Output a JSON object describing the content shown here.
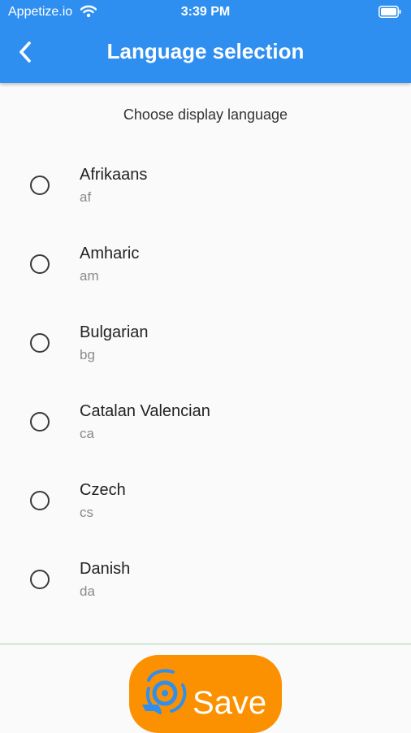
{
  "status_bar": {
    "carrier": "Appetize.io",
    "time": "3:39 PM"
  },
  "header": {
    "title": "Language selection"
  },
  "subtitle": "Choose display language",
  "languages": [
    {
      "name": "Afrikaans",
      "code": "af"
    },
    {
      "name": "Amharic",
      "code": "am"
    },
    {
      "name": "Bulgarian",
      "code": "bg"
    },
    {
      "name": "Catalan Valencian",
      "code": "ca"
    },
    {
      "name": "Czech",
      "code": "cs"
    },
    {
      "name": "Danish",
      "code": "da"
    }
  ],
  "save_button": {
    "label": "Save"
  },
  "colors": {
    "header": "#2f8ff0",
    "save_button": "#fb9100",
    "save_icon": "#2f8ff0",
    "divider": "#a5d3a7"
  },
  "icons": [
    "back-arrow-icon",
    "wifi-icon",
    "battery-icon",
    "save-icon"
  ]
}
